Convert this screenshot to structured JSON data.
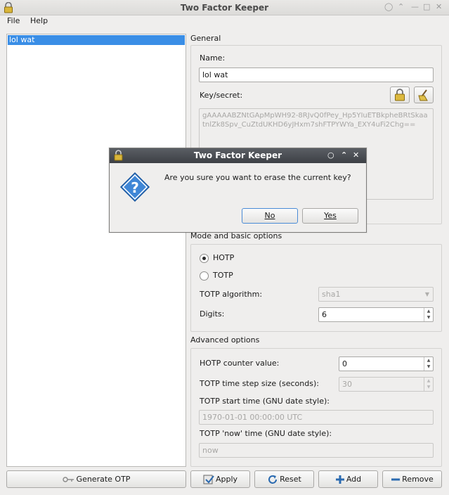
{
  "window": {
    "title": "Two Factor Keeper",
    "controls": [
      "pin-icon",
      "up-icon",
      "minimize-icon",
      "maximize-icon",
      "close-icon"
    ]
  },
  "menu": {
    "file": "File",
    "help": "Help"
  },
  "keylist": {
    "items": [
      "lol wat"
    ]
  },
  "general": {
    "title": "General",
    "name_label": "Name:",
    "name_value": "lol wat",
    "secret_label": "Key/secret:",
    "secret_value": "gAAAAABZNtGApMpWH92-8RJvQ0fPey_Hp5YIuETBkpheBRtSkaatnlZk8Spv_CuZtdUKHD6yJHxm7shFTPYWYa_EXY4uFi2Chg=="
  },
  "mode": {
    "title": "Mode and basic options",
    "hotp_label": "HOTP",
    "totp_label": "TOTP",
    "selected": "HOTP",
    "algorithm_label": "TOTP algorithm:",
    "algorithm_value": "sha1",
    "digits_label": "Digits:",
    "digits_value": "6"
  },
  "advanced": {
    "title": "Advanced options",
    "counter_label": "HOTP counter value:",
    "counter_value": "0",
    "step_label": "TOTP time step size (seconds):",
    "step_value": "30",
    "start_label": "TOTP start time (GNU date style):",
    "start_value": "1970-01-01 00:00:00 UTC",
    "now_label": "TOTP 'now' time (GNU date style):",
    "now_placeholder": "now"
  },
  "buttons": {
    "generate": "Generate OTP",
    "apply": "Apply",
    "reset": "Reset",
    "add": "Add",
    "remove": "Remove"
  },
  "dialog": {
    "title": "Two Factor Keeper",
    "message": "Are you sure you want to erase the current key?",
    "no": "No",
    "yes": "Yes"
  },
  "colors": {
    "selection": "#3a8ee6",
    "dialog_titlebar": "#4a4d52"
  }
}
